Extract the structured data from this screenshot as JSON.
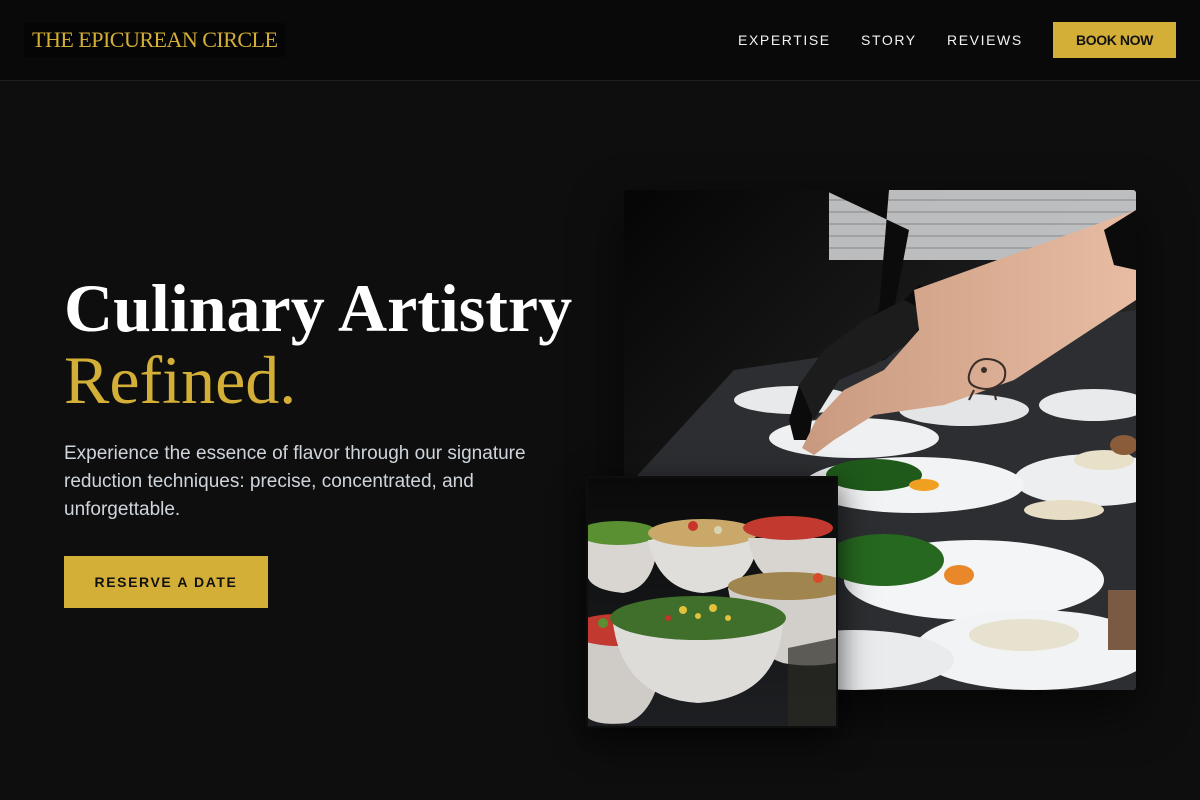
{
  "brand": {
    "name": "THE EPICUREAN CIRCLE"
  },
  "nav": {
    "links": [
      {
        "label": "EXPERTISE"
      },
      {
        "label": "STORY"
      },
      {
        "label": "REVIEWS"
      }
    ],
    "cta_label": "BOOK NOW"
  },
  "hero": {
    "title_line1": "Culinary Artistry",
    "title_line2": "Refined.",
    "description": "Experience the essence of flavor through our signature reduction techniques: precise, concentrated, and unforgettable.",
    "cta_label": "RESERVE A DATE"
  },
  "images": {
    "main": {
      "subject": "chef plating dishes"
    },
    "secondary": {
      "subject": "bowls of salads"
    }
  },
  "colors": {
    "accent": "#d4af37",
    "background": "#0e0e0e",
    "nav_background": "#090909",
    "text": "#ffffff",
    "muted_text": "#cfd5dc"
  }
}
